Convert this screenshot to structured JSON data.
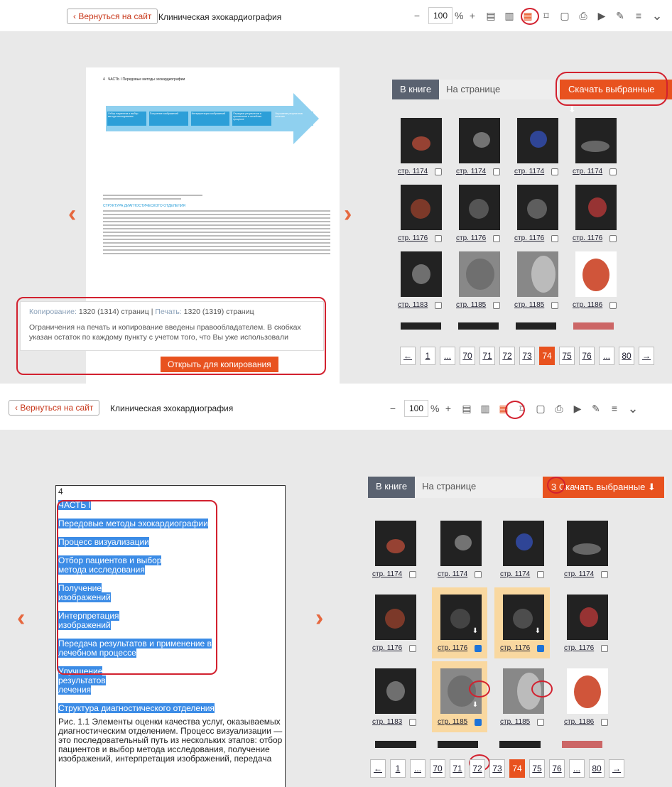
{
  "toolbar": {
    "back_label": "‹ Вернуться на сайт",
    "book_title": "Клиническая эхокардиография",
    "zoom_value": "100",
    "zoom_unit": "%"
  },
  "book_page": {
    "page_number": "4",
    "header": "ЧАСТЬ I  Передовые методы эхокардиографии",
    "diagram_steps": [
      "Отбор пациентов и выбор метода исследования",
      "Получение изображений",
      "Интерпретация изображений",
      "Передача результатов и применение в лечебном процессе",
      "Улучшение результатов лечения"
    ],
    "section_heading": "СТРУКТУРА ДИАГНОСТИЧЕСКОГО ОТДЕЛЕНИЯ"
  },
  "notice": {
    "copy_label": "Копирование:",
    "copy_value": "1320 (1314) страниц",
    "sep": "|",
    "print_label": "Печать:",
    "print_value": "1320 (1319) страниц",
    "text_line1": "Ограничения на печать и копирование введены правообладателем. В скобках",
    "text_line2": "указан остаток по каждому пункту с учетом того, что Вы уже использовали",
    "open_button": "Открыть для копирования"
  },
  "media_panel": {
    "tab_book": "В книге",
    "tab_page": "На странице",
    "download_label": "Скачать выбранные",
    "download_count_2": "3",
    "captions": [
      "стр. 1174",
      "стр. 1174",
      "стр. 1174",
      "стр. 1174",
      "стр. 1176",
      "стр. 1176",
      "стр. 1176",
      "стр. 1176",
      "стр. 1183",
      "стр. 1185",
      "стр. 1185",
      "стр. 1186"
    ]
  },
  "pager": [
    "←",
    "1",
    "...",
    "70",
    "71",
    "72",
    "73",
    "74",
    "75",
    "76",
    "...",
    "80",
    "→"
  ],
  "current_page": "74",
  "text_pane": {
    "page_no": "4",
    "items": [
      "ЧАСТЬ I",
      "Передовые методы эхокардиографии",
      "Процесс визуализации",
      "Отбор пациентов и выбор метода исследования",
      "Получение изображений",
      "Интерпретация изображений",
      "Передача результатов и применение в лечебном процессе",
      "Улучшение результатов лечения",
      "Структура диагностического отделения"
    ],
    "caption": "Рис. 1.1 Элементы оценки качества услуг, оказываемых диагностическим отделением. Процесс визуализации — это последовательный путь из нескольких этапов: отбор пациентов и выбор метода исследования, получение изображений, интерпретация изображений, передача"
  },
  "colors": {
    "accent": "#e8521f",
    "annotation": "#d2212f",
    "selection": "#3c8ce6",
    "tab_active": "#5a6270"
  }
}
